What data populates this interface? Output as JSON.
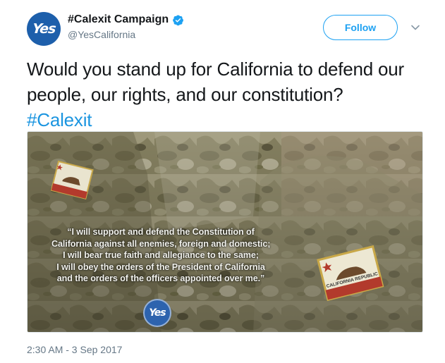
{
  "account": {
    "display_name": "#Calexit Campaign",
    "handle": "@YesCalifornia",
    "avatar_text": "Yes",
    "verified": true
  },
  "actions": {
    "follow_label": "Follow",
    "more_icon": "chevron-down-icon"
  },
  "tweet": {
    "text": "Would you stand up for California to defend our people, our rights, and our constitution?",
    "hashtag": "#Calexit",
    "timestamp": "2:30 AM - 3 Sep 2017"
  },
  "media": {
    "oath_lines": [
      "“I will support and defend the Constitution of",
      "California against all enemies, foreign and domestic;",
      "I will bear true faith and allegiance to the same;",
      "I will obey the orders of the President of California",
      "and the orders of the officers appointed over me.”"
    ],
    "logo_text": "Yes",
    "patch_text": "CALIFORNIA REPUBLIC"
  },
  "colors": {
    "link": "#1b95e0",
    "follow_border": "#1da1f2",
    "muted": "#657786",
    "avatar_bg": "#1d5fab"
  }
}
